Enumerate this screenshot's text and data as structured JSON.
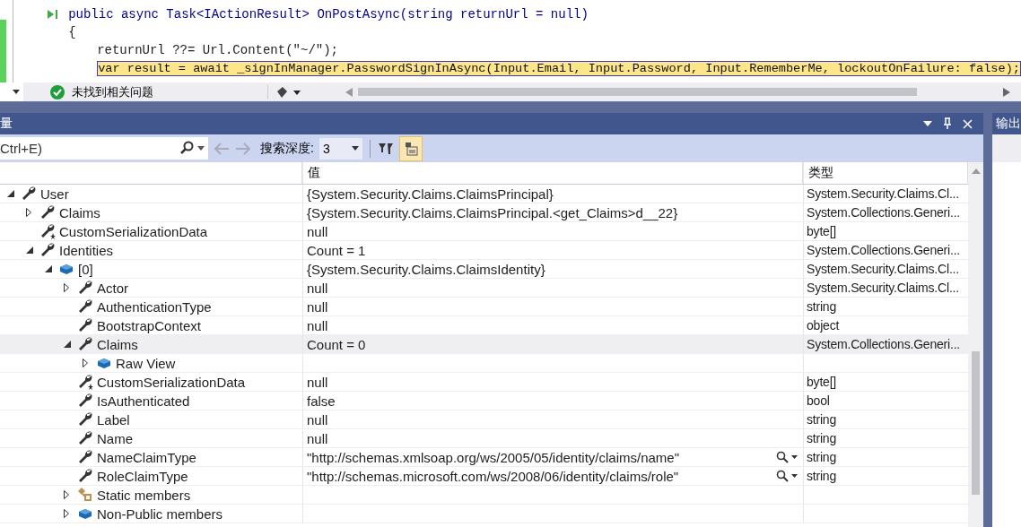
{
  "editor": {
    "lines": [
      {
        "kind": "signature",
        "text": "public async Task<IActionResult> OnPostAsync(string returnUrl = null)"
      },
      {
        "kind": "plain",
        "text": "{"
      },
      {
        "kind": "plain",
        "text": "returnUrl ??= Url.Content(\"~/\");"
      },
      {
        "kind": "current",
        "text": "var result = await _signInManager.PasswordSignInAsync(Input.Email, Input.Password, Input.RememberMe, lockoutOnFailure: false);"
      }
    ]
  },
  "status": {
    "text": "未找到相关问题"
  },
  "panel": {
    "title": "量",
    "search_placeholder": "Ctrl+E)",
    "depth_label": "搜索深度:",
    "depth_value": "3"
  },
  "output_tab": {
    "title": "输出"
  },
  "table": {
    "columns": [
      "值",
      "类型"
    ],
    "rows": [
      {
        "name": "User",
        "kind": "wrench",
        "expanded": true,
        "selected": false,
        "value": "{System.Security.Claims.ClaimsPrincipal}",
        "type": "System.Security.Claims.Cl...",
        "children": [
          {
            "name": "Claims",
            "kind": "wrench",
            "expanded": false,
            "selected": false,
            "value": "{System.Security.Claims.ClaimsPrincipal.<get_Claims>d__22}",
            "type": "System.Collections.Generi..."
          },
          {
            "name": "CustomSerializationData",
            "kind": "wrench-star",
            "selected": false,
            "value": "null",
            "type": "byte[]"
          },
          {
            "name": "Identities",
            "kind": "wrench",
            "expanded": true,
            "selected": false,
            "value": "Count = 1",
            "type": "System.Collections.Generi...",
            "children": [
              {
                "name": "[0]",
                "kind": "cube",
                "expanded": true,
                "selected": false,
                "value": "{System.Security.Claims.ClaimsIdentity}",
                "type": "System.Security.Claims.Cl...",
                "children": [
                  {
                    "name": "Actor",
                    "kind": "wrench",
                    "expanded": false,
                    "selected": false,
                    "value": "null",
                    "type": "System.Security.Claims.Cl..."
                  },
                  {
                    "name": "AuthenticationType",
                    "kind": "wrench",
                    "selected": false,
                    "value": "null",
                    "type": "string"
                  },
                  {
                    "name": "BootstrapContext",
                    "kind": "wrench",
                    "selected": false,
                    "value": "null",
                    "type": "object"
                  },
                  {
                    "name": "Claims",
                    "kind": "wrench",
                    "expanded": true,
                    "selected": true,
                    "value": "Count = 0",
                    "type": "System.Collections.Generi...",
                    "children": [
                      {
                        "name": "Raw View",
                        "kind": "cube",
                        "expanded": false,
                        "selected": false
                      }
                    ]
                  },
                  {
                    "name": "CustomSerializationData",
                    "kind": "wrench-star",
                    "selected": false,
                    "value": "null",
                    "type": "byte[]"
                  },
                  {
                    "name": "IsAuthenticated",
                    "kind": "wrench",
                    "selected": false,
                    "value": "false",
                    "type": "bool"
                  },
                  {
                    "name": "Label",
                    "kind": "wrench",
                    "selected": false,
                    "value": "null",
                    "type": "string"
                  },
                  {
                    "name": "Name",
                    "kind": "wrench",
                    "selected": false,
                    "value": "null",
                    "type": "string"
                  },
                  {
                    "name": "NameClaimType",
                    "kind": "wrench",
                    "selected": false,
                    "value": "\"http://schemas.xmlsoap.org/ws/2005/05/identity/claims/name\"",
                    "viewer": true,
                    "type": "string"
                  },
                  {
                    "name": "RoleClaimType",
                    "kind": "wrench",
                    "selected": false,
                    "value": "\"http://schemas.microsoft.com/ws/2008/06/identity/claims/role\"",
                    "viewer": true,
                    "type": "string"
                  },
                  {
                    "name": "Static members",
                    "kind": "static",
                    "expanded": false,
                    "selected": false
                  },
                  {
                    "name": "Non-Public members",
                    "kind": "cube",
                    "expanded": false,
                    "selected": false
                  }
                ]
              }
            ]
          }
        ]
      }
    ]
  }
}
